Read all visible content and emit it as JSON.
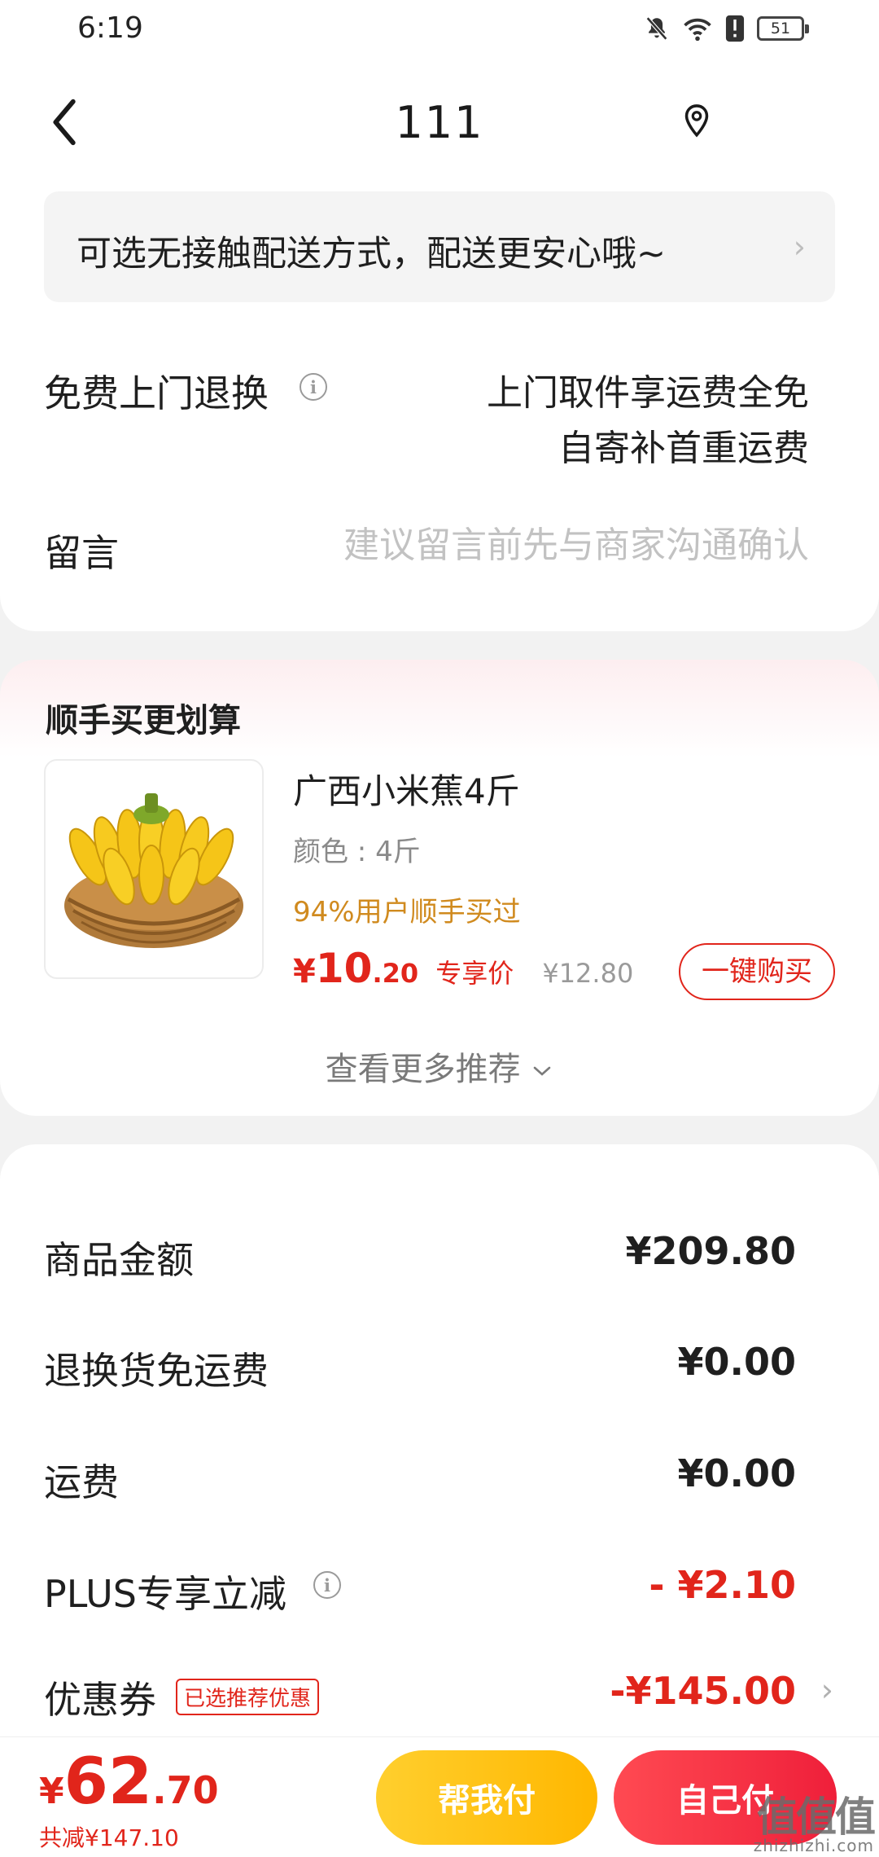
{
  "status_bar": {
    "time": "6:19",
    "battery": "51",
    "icons": [
      "bell-off-icon",
      "wifi-icon",
      "alert-icon",
      "battery-icon"
    ]
  },
  "header": {
    "title": "111",
    "back_icon": "chevron-left-icon",
    "location_icon": "location-pin-icon"
  },
  "notice": {
    "text": "可选无接触配送方式，配送更安心哦~",
    "chevron": "›"
  },
  "return_service": {
    "label": "免费上门退换",
    "info": "i",
    "line1": "上门取件享运费全免",
    "line2": "自寄补首重运费"
  },
  "message": {
    "label": "留言",
    "value": "",
    "placeholder": "建议留言前先与商家沟通确认"
  },
  "recommend": {
    "title": "顺手买更划算",
    "product": {
      "name": "广西小米蕉4斤",
      "spec": "颜色 : 4斤",
      "social_proof": "94%用户顺手买过",
      "price_currency": "¥",
      "price_int": "10",
      "price_dec": ".20",
      "price_tag": "专享价",
      "original_price": "¥12.80",
      "buy_label": "一键购买",
      "image": "banana-bunch-basket"
    },
    "more_label": "查看更多推荐",
    "more_icon": "chevron-down-icon"
  },
  "summary": {
    "rows": [
      {
        "label": "商品金额",
        "value": "¥209.80"
      },
      {
        "label": "退换货免运费",
        "value": "¥0.00"
      },
      {
        "label": "运费",
        "value": "¥0.00"
      },
      {
        "label": "PLUS专享立减",
        "value": "- ¥2.10"
      },
      {
        "label": "优惠券",
        "value": "-¥145.00",
        "badge": "已选推荐优惠"
      }
    ],
    "info": "i",
    "chevron": "›"
  },
  "footer": {
    "currency": "¥",
    "total_int": "62",
    "total_dec": ".70",
    "saved": "共减¥147.10",
    "help_pay": "帮我付",
    "self_pay": "自己付"
  },
  "watermark": {
    "logo": "值值值",
    "url": "zhizhizhi.com"
  },
  "colors": {
    "accent_red": "#e1251b",
    "help_pay_yellow": "#ffb700",
    "self_pay_red": "#ef1f3a",
    "social_orange": "#d08a1e"
  }
}
